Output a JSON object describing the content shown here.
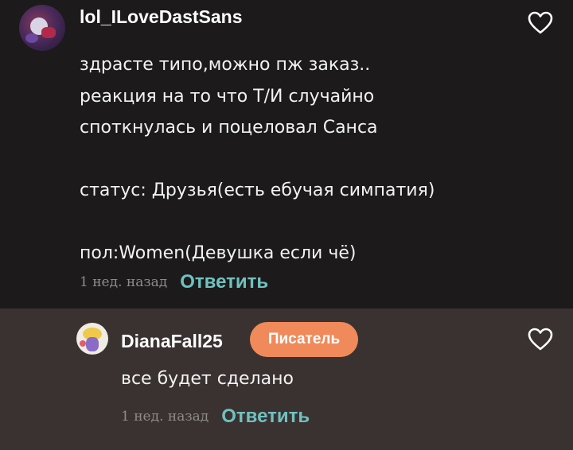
{
  "comment": {
    "username": "lol_ILoveDastSans",
    "avatar_icon": "user-avatar",
    "like_icon": "heart-outline-icon",
    "lines": [
      "здрасте типо,можно пж заказ..",
      "реакция на то что Т/И случайно",
      "споткнулась и поцеловал Санса",
      "",
      "статус: Друзья(есть ебучая симпатия)",
      "",
      "пол:Women(Девушка если чё)"
    ],
    "time": "1 нед. назад",
    "reply_label": "Ответить"
  },
  "reply": {
    "username": "DianaFall25",
    "avatar_icon": "user-avatar",
    "badge": "Писатель",
    "like_icon": "heart-outline-icon",
    "text": "все будет сделано",
    "time": "1 нед. назад",
    "reply_label": "Ответить"
  },
  "colors": {
    "background": "#1c1a1b",
    "reply_background": "#3a3230",
    "accent": "#6fc2c0",
    "badge": "#f08a5a",
    "muted": "#8f8b8d"
  }
}
